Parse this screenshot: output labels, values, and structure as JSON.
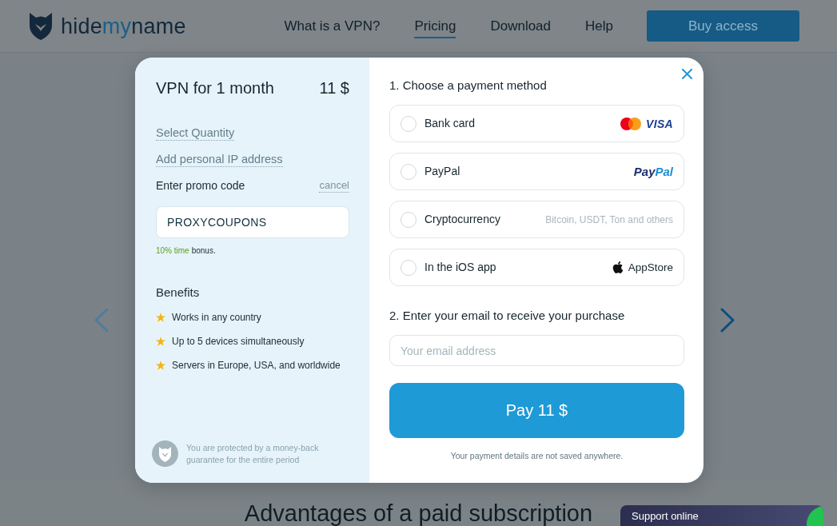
{
  "header": {
    "logo": {
      "parts": [
        "hide",
        "my",
        "name"
      ]
    },
    "nav": [
      {
        "label": "What is a VPN?",
        "selected": false
      },
      {
        "label": "Pricing",
        "selected": true
      },
      {
        "label": "Download",
        "selected": false
      },
      {
        "label": "Help",
        "selected": false
      }
    ],
    "cta": "Buy access"
  },
  "page": {
    "carousel": {
      "prev": {
        "disabled": true
      },
      "next": {
        "disabled": false
      }
    },
    "section_heading": "Advantages of a paid subscription"
  },
  "modal": {
    "summary": {
      "title": "VPN for 1 month",
      "price": "11 $"
    },
    "links": [
      "Select Quantity",
      "Add personal IP address"
    ],
    "promo": {
      "label": "Enter promo code",
      "cancel": "cancel",
      "value": "PROXYCOUPONS",
      "bonus_highlight": "10% time",
      "bonus_text": "bonus."
    },
    "benefits": {
      "title": "Benefits",
      "items": [
        "Works in any country",
        "Up to 5 devices simultaneously",
        "Servers in Europe, USA, and worldwide"
      ]
    },
    "guarantee": "You are protected by a money-back guarantee for the entire period",
    "payment": {
      "title": "1. Choose a payment method",
      "options": [
        {
          "kind": "cards",
          "label": "Bank card",
          "selected": false,
          "brand": "VISA"
        },
        {
          "kind": "paypal",
          "label": "PayPal",
          "selected": false,
          "brand_parts": [
            "Pay",
            "Pal"
          ]
        },
        {
          "kind": "crypto",
          "label": "Cryptocurrency",
          "selected": false,
          "note": "Bitcoin, USDT, Ton and others"
        },
        {
          "kind": "store",
          "label": "In the iOS app",
          "selected": false,
          "brand": "AppStore"
        }
      ]
    },
    "email": {
      "title": "2. Enter your email to receive your purchase",
      "placeholder": "Your email address"
    },
    "pay_button": "Pay 11 $",
    "note": "Your payment details are not saved anywhere."
  },
  "support_widget": {
    "label": "Support online"
  }
}
